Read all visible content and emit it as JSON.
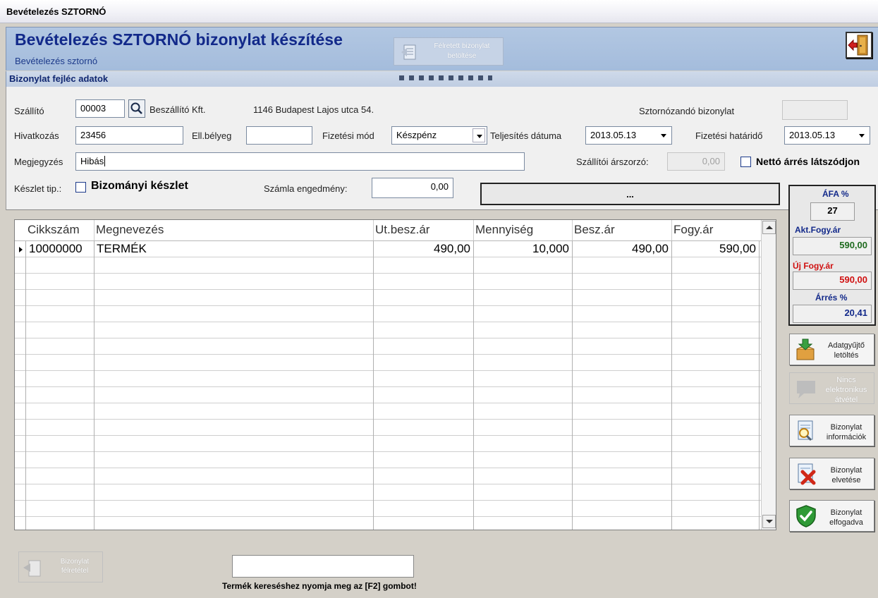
{
  "window": {
    "title": "Bevételezés SZTORNÓ"
  },
  "header": {
    "title": "Bevételezés SZTORNÓ bizonylat készítése",
    "subtitle": "Bevételezés sztornó",
    "held_button_line1": "Félretett bizonylat",
    "held_button_line2": "betöltése",
    "exit_icon": "exit-door-icon"
  },
  "section": {
    "title": "Bizonylat fejléc adatok"
  },
  "form": {
    "supplier_label": "Szállító",
    "supplier_code": "00003",
    "supplier_name": "Beszállító Kft.",
    "supplier_address": "1146 Budapest Lajos utca 54.",
    "storno_doc_label": "Sztornózandó bizonylat",
    "storno_doc_value": "",
    "reference_label": "Hivatkozás",
    "reference_value": "23456",
    "stamp_label": "Ell.bélyeg",
    "stamp_value": "",
    "payment_label": "Fizetési mód",
    "payment_value": "Készpénz",
    "fulfil_label": "Teljesítés dátuma",
    "fulfil_value": "2013.05.13",
    "due_label": "Fizetési határidő",
    "due_value": "2013.05.13",
    "note_label": "Megjegyzés",
    "note_value": "Hibás",
    "supplier_mult_label": "Szállítói árszorzó:",
    "supplier_mult_value": "0,00",
    "net_margin_label": "Nettó árrés látszódjon",
    "stock_type_label": "Készlet tip.:",
    "consign_label": "Bizományi készlet",
    "invoice_discount_label": "Számla engedmény:",
    "invoice_discount_value": "0,00",
    "ellipsis_label": "..."
  },
  "grid": {
    "columns": [
      "Cikkszám",
      "Megnevezés",
      "Ut.besz.ár",
      "Mennyiség",
      "Besz.ár",
      "Fogy.ár"
    ],
    "rows": [
      [
        "10000000",
        "TERMÉK",
        "490,00",
        "10,000",
        "490,00",
        "590,00"
      ]
    ]
  },
  "price_panel": {
    "vat_label": "ÁFA %",
    "vat_value": "27",
    "current_price_label": "Akt.Fogy.ár",
    "current_price_value": "590,00",
    "new_price_label": "Új Fogy.ár",
    "new_price_value": "590,00",
    "margin_label": "Árrés %",
    "margin_value": "20,41"
  },
  "side_buttons": {
    "collector_download": "Adatgyűjtő letöltés",
    "no_electronic": "Nincs elektronikus átvétel",
    "doc_info": "Bizonylat információk",
    "doc_discard": "Bizonylat elvetése",
    "doc_accept": "Bizonylat elfogadva"
  },
  "footer": {
    "park_line1": "Bizonylat",
    "park_line2": "félretétel",
    "search_value": "",
    "hint": "Termék kereséshez nyomja meg az [F2] gombot!"
  },
  "colors": {
    "header_bg": "#a4bcdc",
    "title_blue": "#12298a",
    "current_price_green": "#1f6b1f",
    "new_price_red": "#d01010",
    "margin_blue": "#12298a"
  }
}
